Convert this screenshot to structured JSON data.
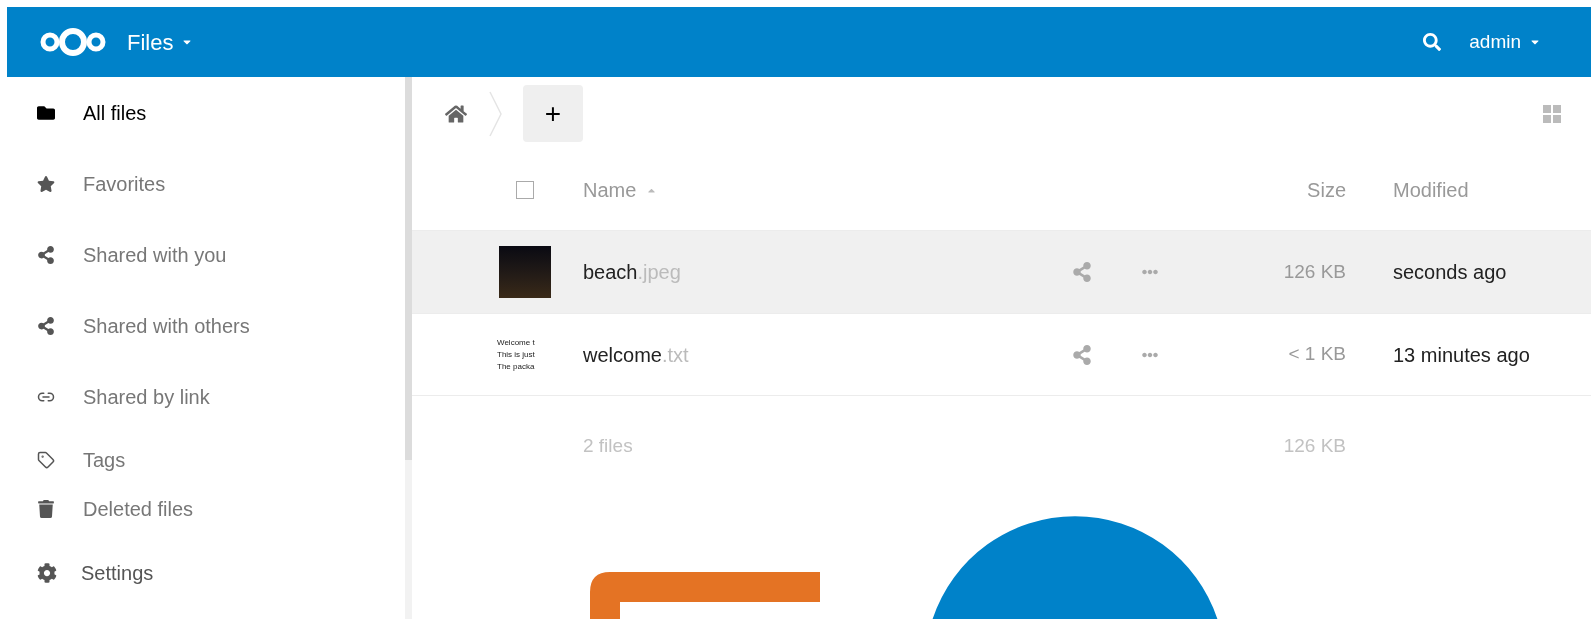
{
  "header": {
    "app_title": "Files",
    "user": "admin"
  },
  "sidebar": {
    "items": [
      {
        "label": "All files",
        "selected": true
      },
      {
        "label": "Favorites",
        "selected": false
      },
      {
        "label": "Shared with you",
        "selected": false
      },
      {
        "label": "Shared with others",
        "selected": false
      },
      {
        "label": "Shared by link",
        "selected": false
      },
      {
        "label": "Tags",
        "selected": false
      },
      {
        "label": "Deleted files",
        "selected": false
      }
    ],
    "settings": "Settings"
  },
  "toolbar": {
    "new_button": "+"
  },
  "table": {
    "select_all": {
      "checked": false
    },
    "columns": {
      "name": "Name",
      "size": "Size",
      "modified": "Modified"
    },
    "rows": [
      {
        "kind": "image",
        "name": "beach",
        "extension": ".jpeg",
        "size": "126 KB",
        "modified": "seconds ago",
        "highlighted": true
      },
      {
        "kind": "text",
        "name": "welcome",
        "extension": ".txt",
        "thumbnail_lines": [
          "Welcome t",
          "This is just",
          "The packa"
        ],
        "size": "< 1 KB",
        "modified": "13 minutes ago",
        "highlighted": false
      }
    ],
    "footer": {
      "count": "2 files",
      "total_size": "126 KB"
    }
  }
}
